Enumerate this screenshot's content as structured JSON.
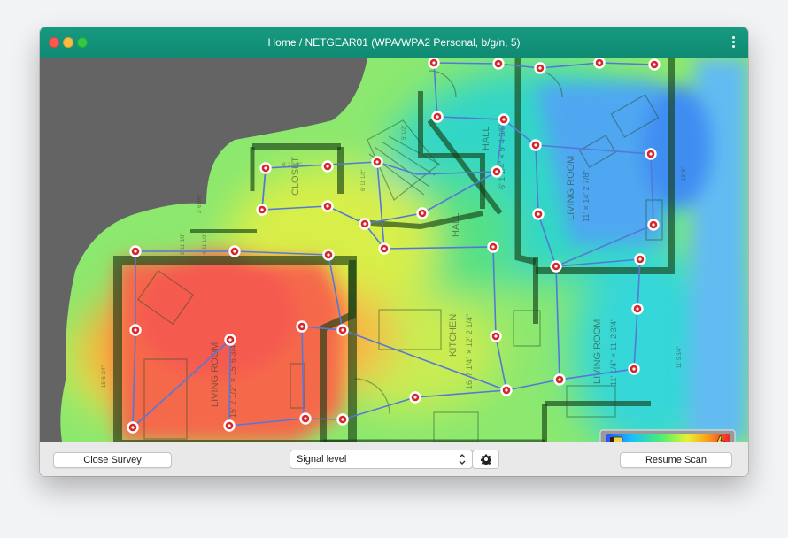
{
  "window": {
    "title": "Home / NETGEAR01 (WPA/WPA2 Personal, b/g/n, 5)"
  },
  "floorplan": {
    "labels": {
      "closet": "CLOSET",
      "hall_top": "HALL",
      "hall_top_dim": "6' 1 1/4\" × 9' 4 3/8\"",
      "hall_mid": "HALL",
      "living_room_top": "LIVING ROOM",
      "living_room_top_dim": "11' × 14' 2 7/8\"",
      "kitchen": "KITCHEN",
      "kitchen_dim": "16' 7 1/4\" × 12' 2 1/4\"",
      "living_room_left": "LIVING ROOM",
      "living_room_left_dim": "15' 2 1/2\" × 15' 6 3/4\"",
      "living_room_right": "LIVING ROOM",
      "living_room_right_dim": "11' 1/4\" × 11' 2 3/4\"",
      "dim_closet_width": "6' 2 1/2\"",
      "dim_closet_side": "2' 6 3/8\"",
      "dim_left_1": "2' 11 3/8\"",
      "dim_left_2": "4' 11 1/2\"",
      "dim_stair": "6' 11 1/2\"",
      "dim_hall_depth": "5' 1/2\"",
      "dim_right_top": "13' 8\"",
      "dim_right_bottom": "11' 5 3/4\"",
      "dim_left_wall": "15' 6 3/4\""
    }
  },
  "legend": {
    "weak_icon": "thumbs-down-icon",
    "strong_icon": "thumbs-up-icon"
  },
  "colors": {
    "titlebar": "#129582",
    "survey_point": "#d7262c",
    "survey_path": "#5478d8",
    "signal_strong": "#f43c3c",
    "signal_weak": "#3c7cf4"
  },
  "toolbar": {
    "close_survey": "Close Survey",
    "visualization_select": "Signal level",
    "resume_scan": "Resume Scan",
    "settings_icon": "gear-icon",
    "select_arrows_icon": "chevron-updown-icon"
  }
}
